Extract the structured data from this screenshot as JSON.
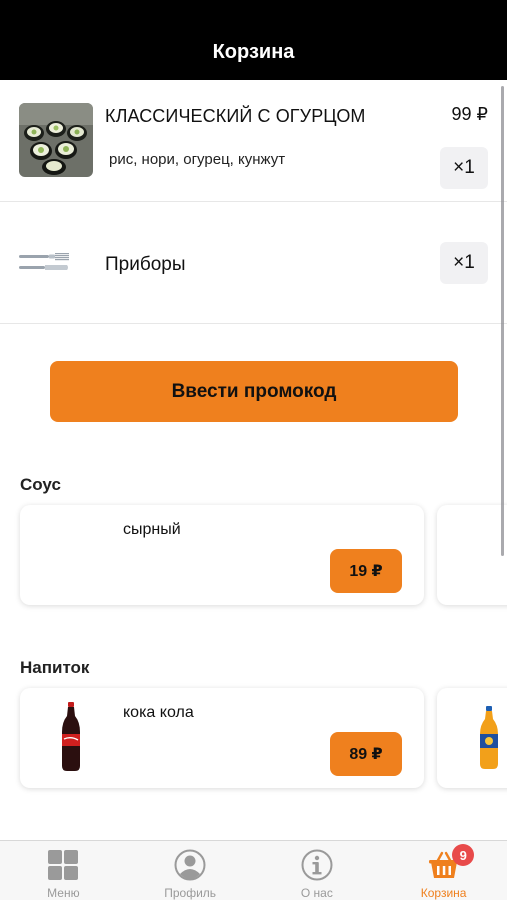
{
  "header": {
    "title": "Корзина"
  },
  "cart": {
    "items": [
      {
        "name": "КЛАССИЧЕСКИЙ С ОГУРЦОМ",
        "price": "99 ₽",
        "description": "рис, нори, огурец, кунжут",
        "quantity": "×1"
      },
      {
        "name": "Приборы",
        "quantity": "×1"
      }
    ]
  },
  "promo": {
    "label": "Ввести промокод"
  },
  "sections": [
    {
      "title": "Соус",
      "cards": [
        {
          "name": "сырный",
          "price": "19 ₽"
        }
      ]
    },
    {
      "title": "Напиток",
      "cards": [
        {
          "name": "кока кола",
          "price": "89 ₽"
        }
      ]
    }
  ],
  "tabbar": {
    "items": [
      {
        "label": "Меню",
        "icon": "grid-icon"
      },
      {
        "label": "Профиль",
        "icon": "profile-icon"
      },
      {
        "label": "О нас",
        "icon": "info-icon"
      },
      {
        "label": "Корзина",
        "icon": "basket-icon",
        "badge": "9"
      }
    ]
  },
  "colors": {
    "accent": "#ef801e",
    "header_bg": "#000000",
    "badge": "#e84a4a",
    "tab_inactive": "#9a9a9a"
  }
}
